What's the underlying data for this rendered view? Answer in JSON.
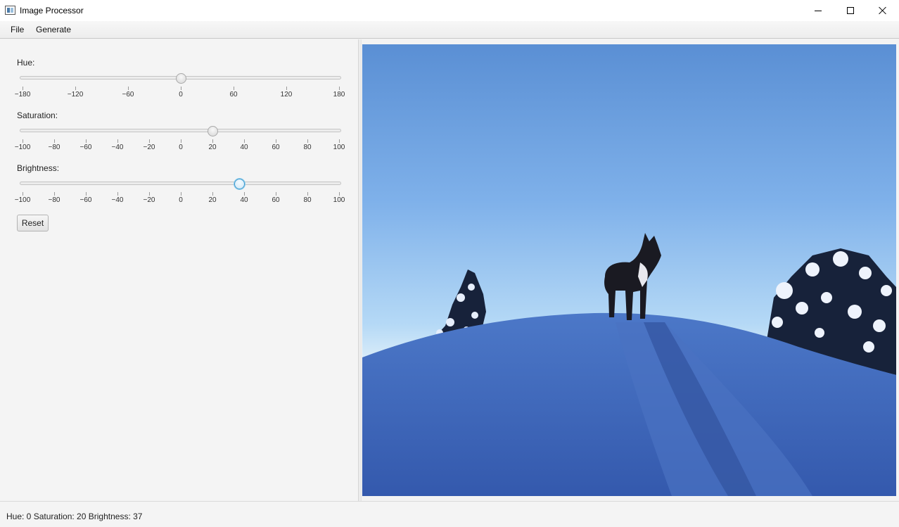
{
  "window": {
    "title": "Image Processor",
    "icon": "app-window-icon"
  },
  "menu": {
    "file": "File",
    "generate": "Generate"
  },
  "controls": {
    "sliders": [
      {
        "id": "hue",
        "label": "Hue:",
        "min": -180,
        "max": 180,
        "value": 0,
        "focused": false,
        "ticks": [
          "−180",
          "−120",
          "−60",
          "0",
          "60",
          "120",
          "180"
        ]
      },
      {
        "id": "saturation",
        "label": "Saturation:",
        "min": -100,
        "max": 100,
        "value": 20,
        "focused": false,
        "ticks": [
          "−100",
          "−80",
          "−60",
          "−40",
          "−20",
          "0",
          "20",
          "40",
          "60",
          "80",
          "100"
        ]
      },
      {
        "id": "brightness",
        "label": "Brightness:",
        "min": -100,
        "max": 100,
        "value": 37,
        "focused": true,
        "ticks": [
          "−100",
          "−80",
          "−60",
          "−40",
          "−20",
          "0",
          "20",
          "40",
          "60",
          "80",
          "100"
        ]
      }
    ],
    "reset_label": "Reset"
  },
  "image": {
    "description_icon": "photo-dog-on-snowy-hill",
    "sky_top": "#5b8fd6",
    "sky_horizon": "#d8ecf8",
    "snow": "#3a62b8"
  },
  "status": {
    "text": "Hue: 0 Saturation: 20 Brightness: 37"
  },
  "colors": {
    "focus_accent": "#3a9bd1"
  }
}
